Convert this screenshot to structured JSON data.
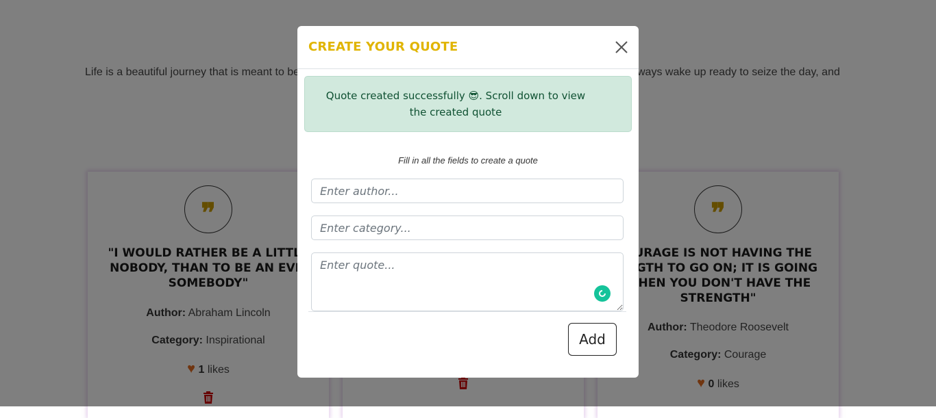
{
  "intro": {
    "left_text": "Life is a beautiful journey that is meant to be",
    "right_text": "ways wake up ready to seize the day, and"
  },
  "cards": [
    {
      "quote_icon": "quote-icon",
      "quote": "\"I would rather be a little nobody, than to be an evil somebody\"",
      "author_label": "Author:",
      "author": "Abraham Lincoln",
      "category_label": "Category:",
      "category": "Inspirational",
      "likes_count": "1",
      "likes_label": "likes"
    },
    {
      "delete_icon": "trash-icon"
    },
    {
      "quote_icon": "quote-icon",
      "quote": "ourage is not having the ength to go on; it is going  when you don't have the strength\"",
      "author_label": "Author:",
      "author": "Theodore Roosevelt",
      "category_label": "Category:",
      "category": "Courage",
      "likes_count": "0",
      "likes_label": "likes"
    }
  ],
  "modal": {
    "title": "CREATE YOUR QUOTE",
    "close_icon": "close-icon",
    "alert_message": "Quote created successfully 😎. Scroll down to view the created quote",
    "hint": "Fill in all the fields to create a quote",
    "author_placeholder": "Enter author...",
    "category_placeholder": "Enter category...",
    "quote_placeholder": "Enter quote...",
    "add_label": "Add"
  },
  "colors": {
    "title": "#e0b400",
    "alert_bg": "#d1e9dd",
    "alert_text": "#0f5132",
    "heart": "#e06a20",
    "trash": "#cc0000",
    "overlay": "rgba(0,0,0,0.5)"
  }
}
